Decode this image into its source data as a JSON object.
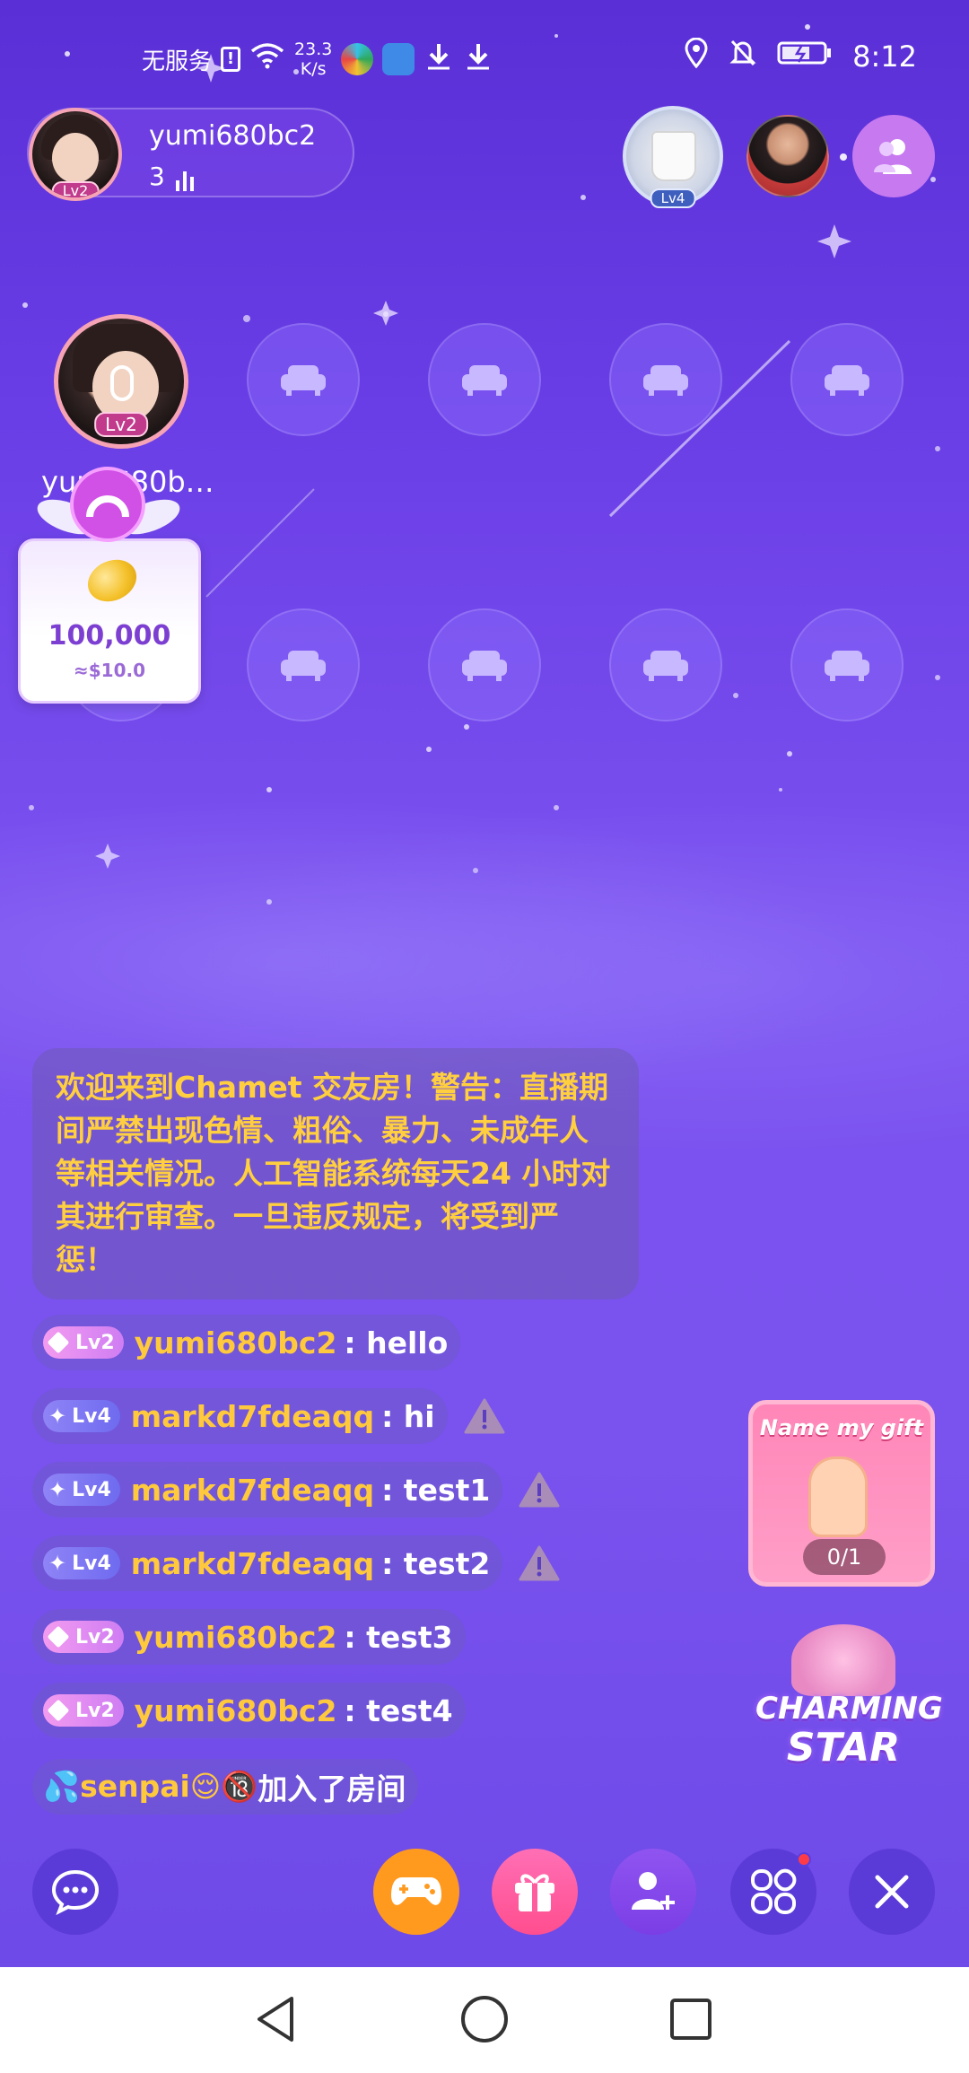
{
  "status_bar": {
    "carrier": "无服务",
    "speed_value": "23.3",
    "speed_unit": "K/s",
    "time": "8:12"
  },
  "room": {
    "host_name": "yumi680bc2",
    "listener_count": "3",
    "host_level": "Lv2",
    "viewer_level": "Lv4",
    "seat_owner_name": "yumi680b…"
  },
  "gift_card": {
    "amount": "100,000",
    "usd": "≈$10.0"
  },
  "announcement": "欢迎来到Chamet 交友房！警告：直播期间严禁出现色情、粗俗、暴力、未成年人等相关情况。人工智能系统每天24 小时对其进行审查。一旦违反规定，将受到严惩！",
  "messages": [
    {
      "level": "Lv2",
      "user": "yumi680bc2",
      "text": ": hello",
      "warn": false
    },
    {
      "level": "Lv4",
      "user": "markd7fdeaqq",
      "text": ": hi",
      "warn": true
    },
    {
      "level": "Lv4",
      "user": "markd7fdeaqq",
      "text": ": test1",
      "warn": true
    },
    {
      "level": "Lv4",
      "user": "markd7fdeaqq",
      "text": ": test2",
      "warn": true
    },
    {
      "level": "Lv2",
      "user": "yumi680bc2",
      "text": ": test3",
      "warn": false
    },
    {
      "level": "Lv2",
      "user": "yumi680bc2",
      "text": ": test4",
      "warn": false
    }
  ],
  "join_message": {
    "user": "💦senpai😌🔞",
    "text": " 加入了房间"
  },
  "promos": {
    "name_gift_title": "Name my gift",
    "name_gift_count": "0/1",
    "charming_line1": "CHARMING",
    "charming_line2": "STAR"
  },
  "colors": {
    "accent_yellow": "#ffc93d",
    "background_purple": "#7c52f0",
    "game_orange": "#ff9a1f",
    "gift_pink": "#ff5e9e"
  }
}
